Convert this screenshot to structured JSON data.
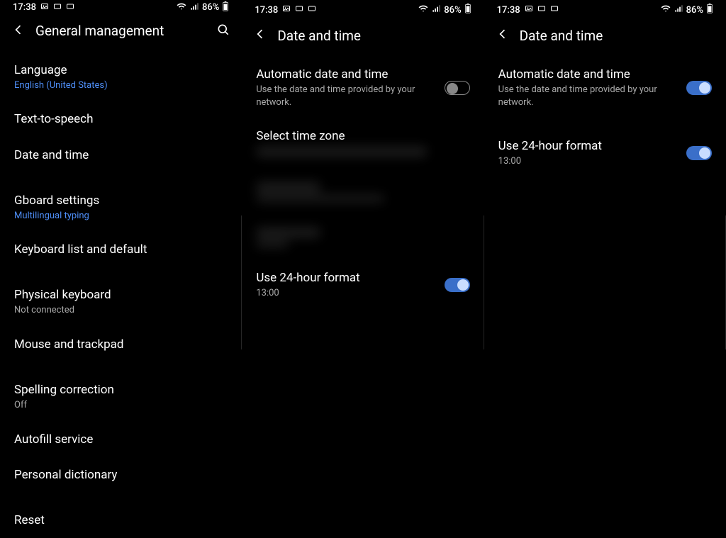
{
  "status": {
    "time": "17:38",
    "battery": "86%"
  },
  "panel1": {
    "title": "General management",
    "items": [
      {
        "label": "Language",
        "sub": "English (United States)",
        "subStyle": "blue"
      },
      {
        "label": "Text-to-speech"
      },
      {
        "label": "Date and time"
      },
      {
        "label": "Gboard settings",
        "sub": "Multilingual typing",
        "subStyle": "blue"
      },
      {
        "label": "Keyboard list and default"
      },
      {
        "label": "Physical keyboard",
        "sub": "Not connected",
        "subStyle": "gray"
      },
      {
        "label": "Mouse and trackpad"
      },
      {
        "label": "Spelling correction",
        "sub": "Off",
        "subStyle": "gray"
      },
      {
        "label": "Autofill service"
      },
      {
        "label": "Personal dictionary"
      },
      {
        "label": "Reset"
      }
    ]
  },
  "panel2": {
    "title": "Date and time",
    "autoDate": {
      "label": "Automatic date and time",
      "sub": "Use the date and time provided by your network.",
      "on": false
    },
    "selectTz": {
      "label": "Select time zone"
    },
    "use24": {
      "label": "Use 24-hour format",
      "sub": "13:00",
      "on": true
    }
  },
  "panel3": {
    "title": "Date and time",
    "autoDate": {
      "label": "Automatic date and time",
      "sub": "Use the date and time provided by your network.",
      "on": true
    },
    "use24": {
      "label": "Use 24-hour format",
      "sub": "13:00",
      "on": true
    }
  }
}
